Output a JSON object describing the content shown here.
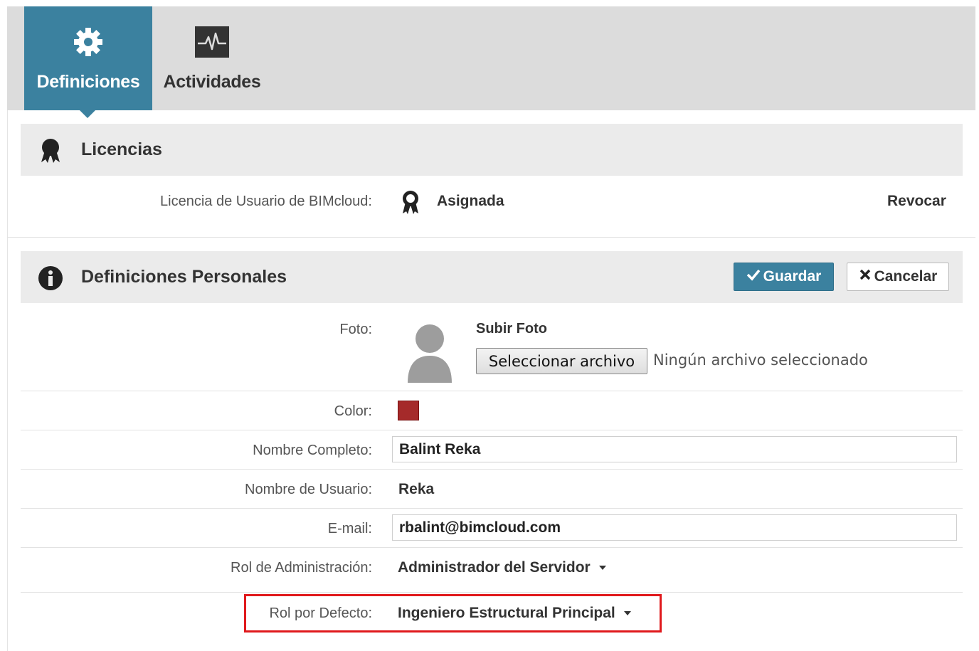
{
  "tabs": [
    {
      "label": "Definiciones",
      "icon": "gear-icon",
      "active": true
    },
    {
      "label": "Actividades",
      "icon": "activity-icon",
      "active": false
    }
  ],
  "colors": {
    "accent": "#3b819f",
    "user_color": "#a52a2a",
    "highlight": "#e0191c"
  },
  "licenses": {
    "title": "Licencias",
    "icon": "award-ribbon-icon",
    "row_label": "Licencia de Usuario de BIMcloud:",
    "status": "Asignada",
    "revoke_label": "Revocar"
  },
  "personal": {
    "title": "Definiciones Personales",
    "icon": "info-icon",
    "save_label": "Guardar",
    "cancel_label": "Cancelar",
    "photo": {
      "label": "Foto:",
      "upload_title": "Subir Foto",
      "choose_button": "Seleccionar archivo",
      "no_file": "Ningún archivo seleccionado"
    },
    "color_label": "Color:",
    "fullname_label": "Nombre Completo:",
    "fullname_value": "Balint Reka",
    "username_label": "Nombre de Usuario:",
    "username_value": "Reka",
    "email_label": "E-mail:",
    "email_value": "rbalint@bimcloud.com",
    "admin_role_label": "Rol de Administración:",
    "admin_role_value": "Administrador del Servidor",
    "default_role_label": "Rol por Defecto:",
    "default_role_value": "Ingeniero Estructural Principal"
  }
}
